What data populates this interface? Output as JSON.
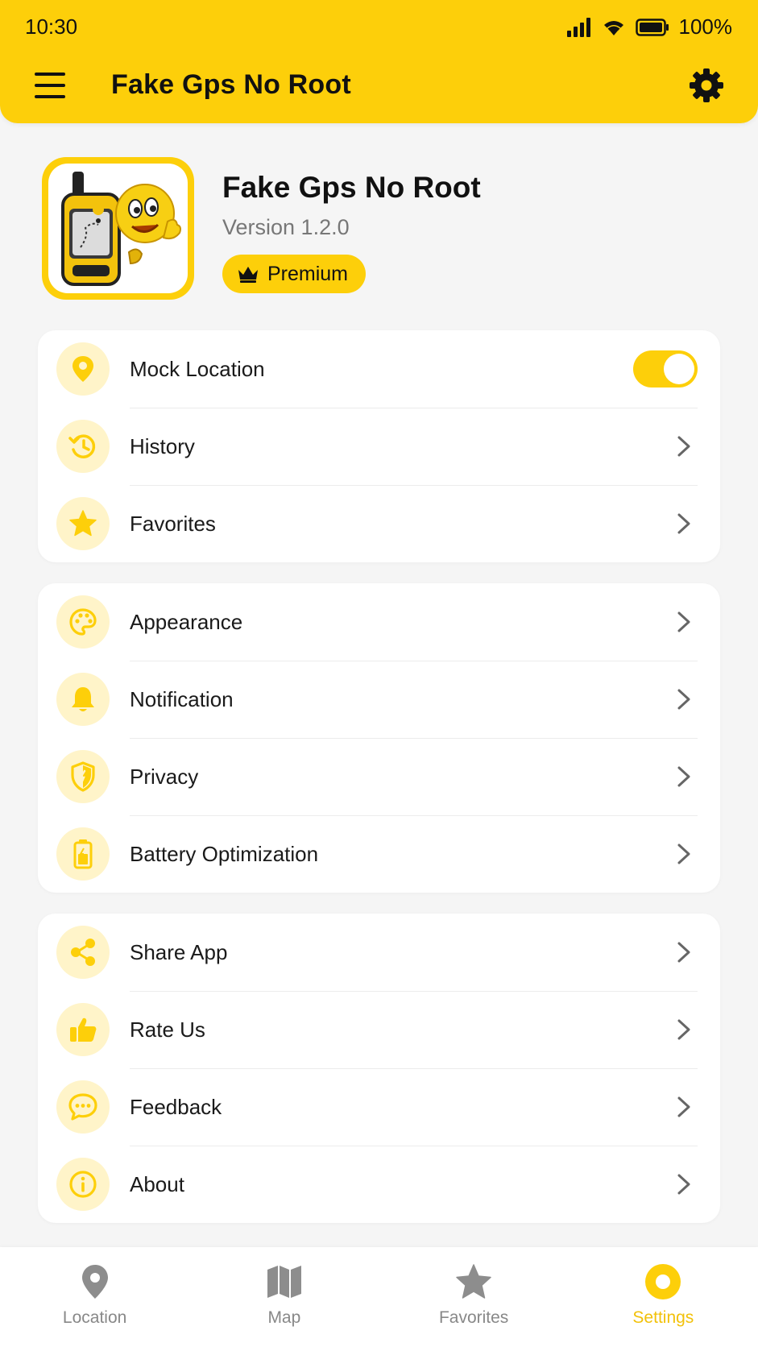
{
  "status_bar": {
    "time": "10:30",
    "battery_pct": "100%"
  },
  "app_bar": {
    "title": "Fake Gps No Root"
  },
  "header": {
    "name": "Fake Gps No Root",
    "version": "Version 1.2.0",
    "premium_label": "Premium"
  },
  "group1": [
    {
      "label": "Mock Location",
      "icon": "location-pin-icon",
      "toggle_on": true
    },
    {
      "label": "History",
      "icon": "history-icon"
    },
    {
      "label": "Favorites",
      "icon": "star-icon"
    }
  ],
  "group2": [
    {
      "label": "Appearance",
      "icon": "palette-icon"
    },
    {
      "label": "Notification",
      "icon": "bell-icon"
    },
    {
      "label": "Privacy",
      "icon": "shield-icon"
    },
    {
      "label": "Battery Optimization",
      "icon": "battery-icon"
    }
  ],
  "group3": [
    {
      "label": "Share App",
      "icon": "share-icon"
    },
    {
      "label": "Rate Us",
      "icon": "thumbs-up-icon"
    },
    {
      "label": "Feedback",
      "icon": "chat-icon"
    },
    {
      "label": "About",
      "icon": "info-icon"
    }
  ],
  "bottom_nav": [
    {
      "label": "Location",
      "icon": "location-pin-icon",
      "active": false
    },
    {
      "label": "Map",
      "icon": "map-icon",
      "active": false
    },
    {
      "label": "Favorites",
      "icon": "star-icon",
      "active": false
    },
    {
      "label": "Settings",
      "icon": "settings-circle-icon",
      "active": true
    }
  ],
  "colors": {
    "accent": "#fdcf0a",
    "icon_bg": "#fff4c9",
    "nav_active": "#f2c10a",
    "nav_inactive": "#888888"
  }
}
